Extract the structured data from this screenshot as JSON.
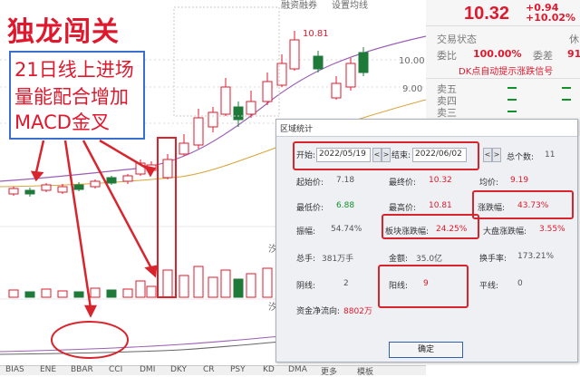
{
  "headline": "独龙闯关",
  "annotation_lines": [
    "21日线上进场",
    "量能配合增加",
    "MACD金叉"
  ],
  "chart_top_labels": {
    "financing": "融资融券",
    "settings": "设置均线"
  },
  "chart_price_marks": {
    "high_label": "10.81",
    "axis_10": "10.00",
    "axis_9": "9.00"
  },
  "chart_side_label": "汐",
  "quote": {
    "price": "10.32",
    "change": "+0.94",
    "change_pct": "+10.02%"
  },
  "right_panel": {
    "trade_status_label": "交易状态",
    "trade_status_value": "休",
    "commission_ratio_label": "委比",
    "commission_ratio_value": "100.00%",
    "commission_diff_label": "委差",
    "commission_diff_value": "91",
    "signal_text": "DK点自动提示涨跌信号",
    "sell_levels": [
      "卖五",
      "卖四",
      "卖三"
    ]
  },
  "dialog": {
    "title": "区域统计",
    "start_label": "开始:",
    "start_date": "2022/05/19",
    "end_label": "结束:",
    "end_date": "2022/06/02",
    "total_count_label": "总个数:",
    "total_count": "11",
    "rows": [
      [
        {
          "label": "起始价:",
          "value": "7.18",
          "color": "gray"
        },
        {
          "label": "最终价:",
          "value": "10.32",
          "color": "red"
        },
        {
          "label": "均价:",
          "value": "9.19",
          "color": "red"
        }
      ],
      [
        {
          "label": "最低价:",
          "value": "6.88",
          "color": "green"
        },
        {
          "label": "最高价:",
          "value": "10.81",
          "color": "red"
        },
        {
          "label": "涨跌幅:",
          "value": "43.73%",
          "color": "red"
        }
      ],
      [
        {
          "label": "振幅:",
          "value": "54.74%",
          "color": "gray"
        },
        {
          "label": "板块涨跌幅:",
          "value": "24.25%",
          "color": "red"
        },
        {
          "label": "大盘涨跌幅:",
          "value": "3.55%",
          "color": "red"
        }
      ],
      [
        {
          "label": "总手:",
          "value": "381万手",
          "color": "gray"
        },
        {
          "label": "金额:",
          "value": "35.0亿",
          "color": "gray"
        },
        {
          "label": "换手率:",
          "value": "173.21%",
          "color": "gray"
        }
      ],
      [
        {
          "label": "阴线:",
          "value": "2",
          "color": "gray"
        },
        {
          "label": "阳线:",
          "value": "9",
          "color": "red"
        },
        {
          "label": "平线:",
          "value": "0",
          "color": "gray"
        }
      ]
    ],
    "net_inflow_label": "资金净流向:",
    "net_inflow_value": "8802万",
    "ok_label": "确定"
  },
  "bottom_tabs": [
    "BIAS",
    "ENE",
    "BBAR",
    "CCI",
    "DMI",
    "DKY",
    "CR",
    "PSY",
    "KD",
    "DMA",
    "更多",
    "模板"
  ],
  "colors": {
    "accent_red": "#e0182d",
    "up_candle": "#e0182d",
    "down_candle": "#1f7a3a",
    "box_blue": "#3a6fd0"
  }
}
